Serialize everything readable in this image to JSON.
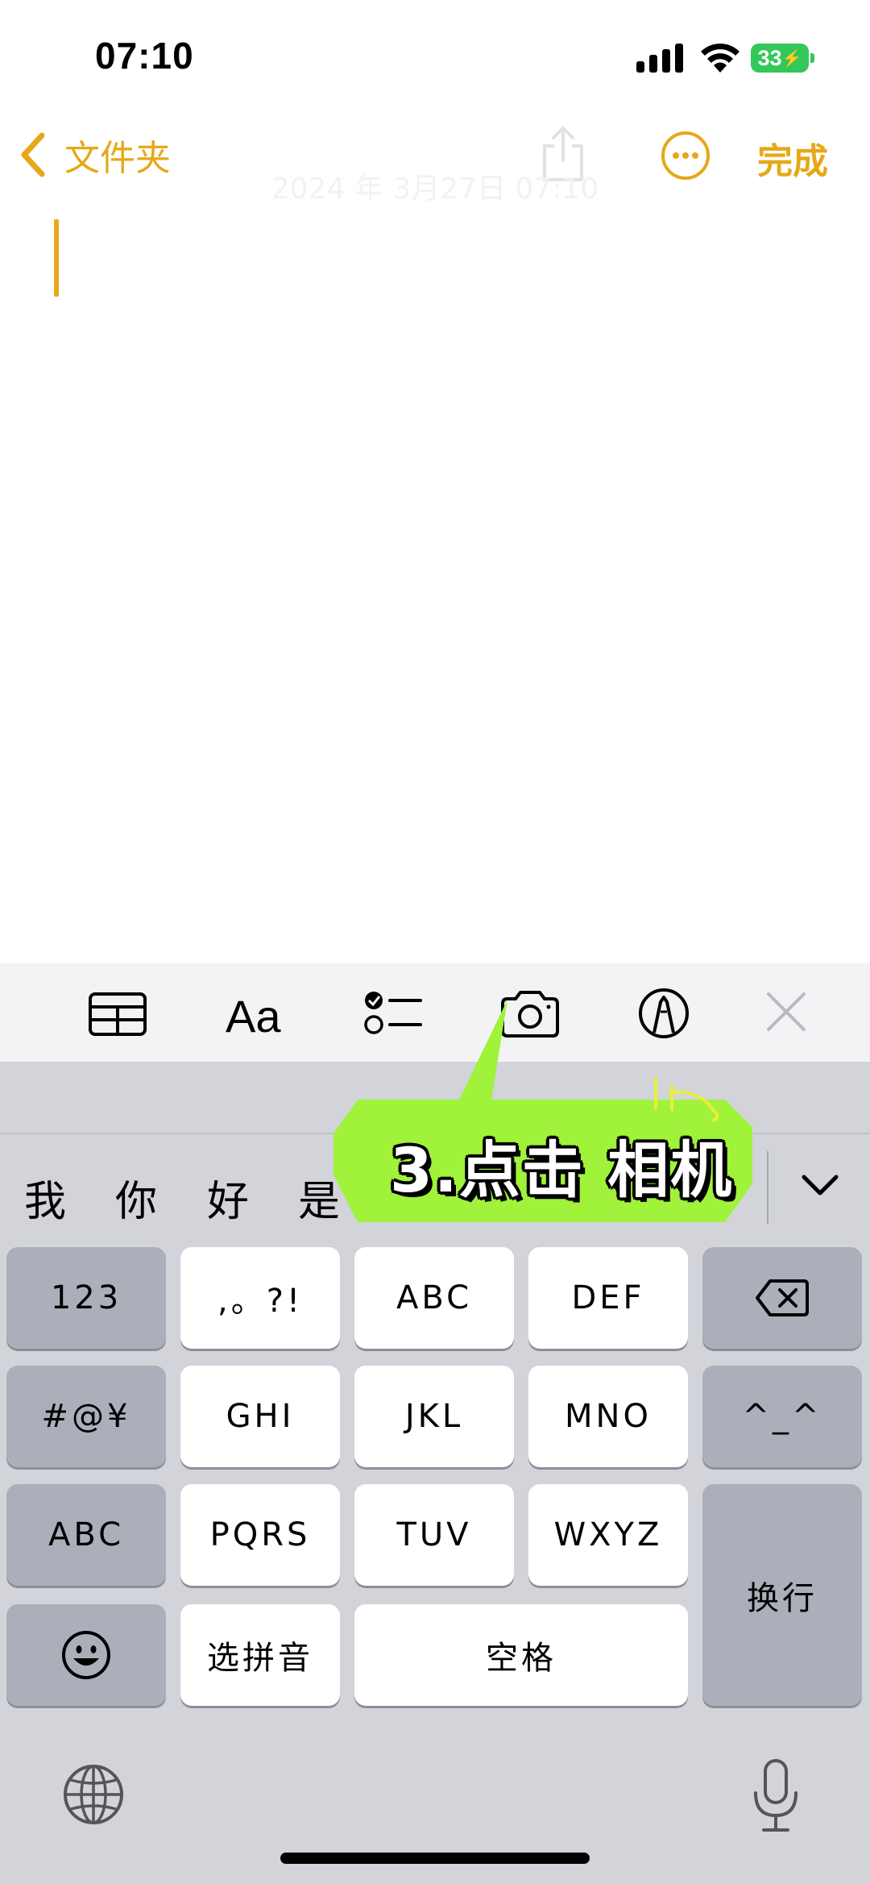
{
  "status_bar": {
    "time": "07:10",
    "battery": "33"
  },
  "nav": {
    "back_label": "文件夹",
    "done_label": "完成"
  },
  "note": {
    "date": "2024 年 3月27日 07:10"
  },
  "toolbar": {
    "format_label": "Aa"
  },
  "candidates": [
    "我",
    "你",
    "好",
    "是"
  ],
  "keys": {
    "numbers": "123",
    "punct": ",。?!",
    "abc": "ABC",
    "def": "DEF",
    "symbols": "#@¥",
    "ghi": "GHI",
    "jkl": "JKL",
    "mno": "MNO",
    "emoticon": "^_^",
    "abc_switch": "ABC",
    "pqrs": "PQRS",
    "tuv": "TUV",
    "wxyz": "WXYZ",
    "return": "换行",
    "pinyin": "选拼音",
    "space": "空格"
  },
  "callout": {
    "text": "3.点击 相机"
  },
  "colors": {
    "accent": "#e6a817",
    "callout": "#a0f23a",
    "battery": "#34c759"
  }
}
